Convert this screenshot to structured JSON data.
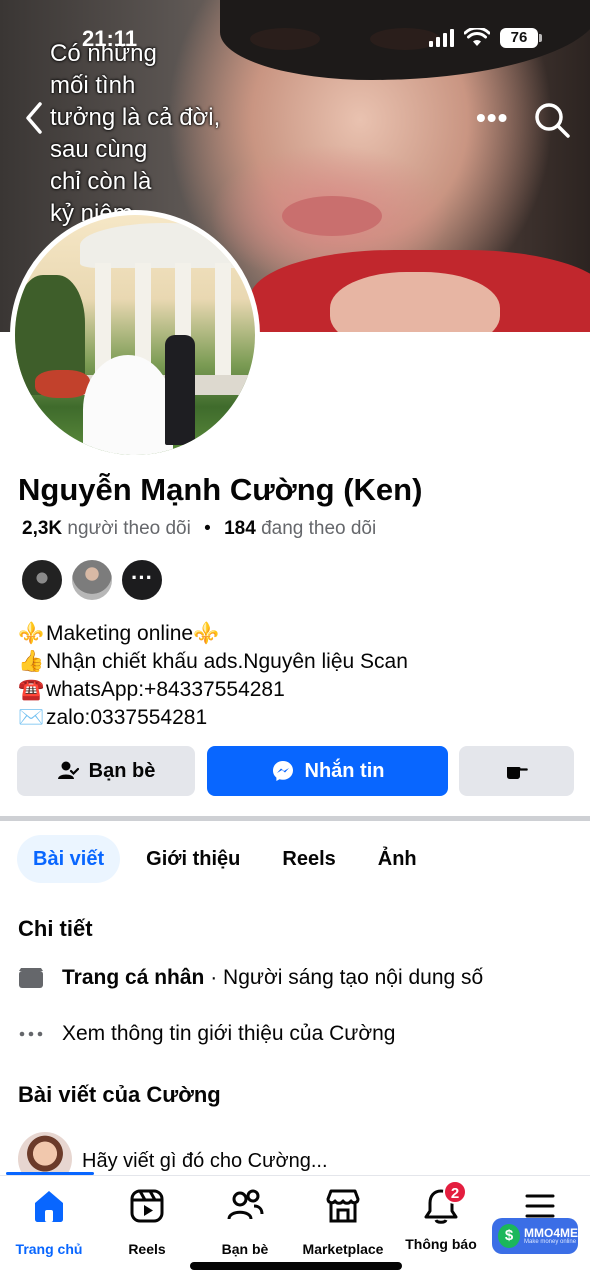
{
  "status_bar": {
    "time": "21:11",
    "battery": "76"
  },
  "cover": {
    "overlay_text": "Có những\nmối tình\ntưởng là cả đời,\nsau cùng\nchỉ còn là\nkỷ niệm"
  },
  "header": {
    "back_icon": "chevron-left-icon",
    "more_label": "•••",
    "search_icon": "search-icon"
  },
  "profile": {
    "name": "Nguyễn Mạnh Cường (Ken)",
    "followers_count": "2,3K",
    "followers_label": "người theo dõi",
    "following_count": "184",
    "following_label": "đang theo dõi",
    "separator": "•",
    "mutual_more": "···",
    "bio": [
      {
        "icon": "⚜️",
        "text": "Maketing online⚜️"
      },
      {
        "icon": "👍",
        "text": "Nhận chiết khấu ads.Nguyên liệu Scan"
      },
      {
        "icon": "☎️",
        "text": "whatsApp:+84337554281"
      },
      {
        "icon": "✉️",
        "text": "zalo:0337554281"
      }
    ]
  },
  "actions": {
    "friends_label": "Bạn bè",
    "message_label": "Nhắn tin",
    "accent_color": "#0866ff"
  },
  "tabs": [
    {
      "label": "Bài viết",
      "active": true
    },
    {
      "label": "Giới thiệu",
      "active": false
    },
    {
      "label": "Reels",
      "active": false
    },
    {
      "label": "Ảnh",
      "active": false
    }
  ],
  "details": {
    "title": "Chi tiết",
    "page_type_bold": "Trang cá nhân",
    "page_type_rest": " · Người sáng tạo nội dung số",
    "see_about": "Xem thông tin giới thiệu của Cường"
  },
  "posts": {
    "title": "Bài viết của Cường",
    "composer_placeholder": "Hãy viết gì đó cho Cường..."
  },
  "bottom_nav": [
    {
      "label": "Trang chủ",
      "icon": "home-icon",
      "active": true
    },
    {
      "label": "Reels",
      "icon": "reels-icon",
      "active": false
    },
    {
      "label": "Bạn bè",
      "icon": "friends-icon",
      "active": false
    },
    {
      "label": "Marketplace",
      "icon": "marketplace-icon",
      "active": false
    },
    {
      "label": "Thông báo",
      "icon": "bell-icon",
      "active": false,
      "badge": "2"
    },
    {
      "label": "",
      "icon": "menu-icon",
      "active": false
    }
  ],
  "watermark": {
    "text": "MMO4ME",
    "sub": "Make money online",
    "coin": "$"
  }
}
